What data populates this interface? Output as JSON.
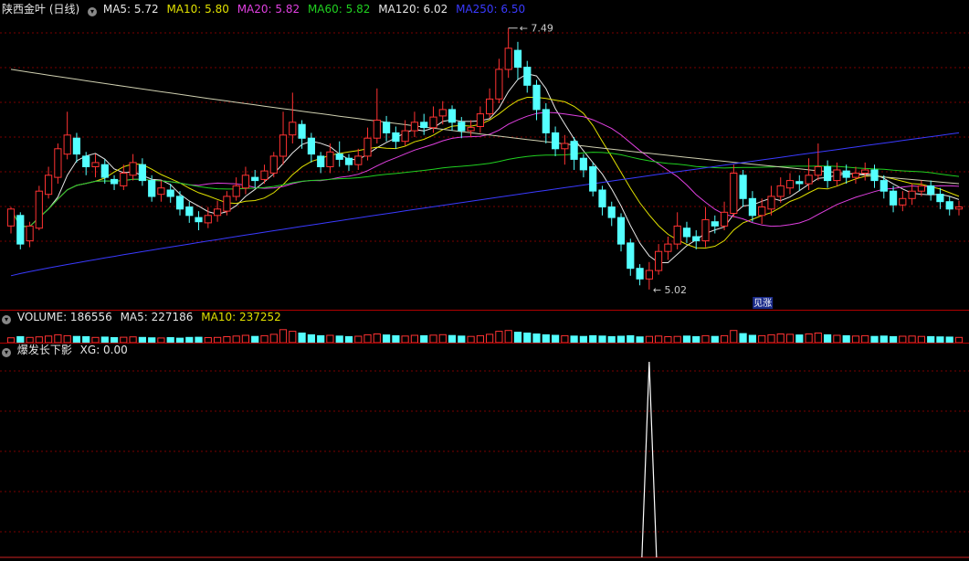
{
  "main": {
    "title": "陕西金叶 (日线)",
    "indicators": [
      {
        "label": "MA5: 5.72",
        "color": "#e6e6e6",
        "name": "ma5"
      },
      {
        "label": "MA10: 5.80",
        "color": "#e0e000",
        "name": "ma10"
      },
      {
        "label": "MA20: 5.82",
        "color": "#e040e0",
        "name": "ma20"
      },
      {
        "label": "MA60: 5.82",
        "color": "#20d020",
        "name": "ma60"
      },
      {
        "label": "MA120: 6.02",
        "color": "#cfcfb0",
        "name": "ma120"
      },
      {
        "label": "MA250: 6.50",
        "color": "#3a3aff",
        "name": "ma250"
      }
    ],
    "high_label": "7.49",
    "low_label": "5.02",
    "marker_label": "见涨"
  },
  "volume": {
    "title": "VOLUME: 186556",
    "ma5": "MA5: 227186",
    "ma10": "MA10: 237252"
  },
  "indicator": {
    "title": "爆发长下影",
    "value": "XG: 0.00"
  },
  "colors": {
    "up": "#ff3232",
    "down": "#54ffff",
    "grid": "#7a0000",
    "border": "#b00000"
  },
  "chart_data": {
    "type": "candlestick",
    "price_range": [
      4.95,
      7.6
    ],
    "extremes": {
      "high": 7.49,
      "low": 5.02
    },
    "moving_averages": {
      "MA5": 5.72,
      "MA10": 5.8,
      "MA20": 5.82,
      "MA60": 5.82,
      "MA120": 6.02,
      "MA250": 6.5
    },
    "candles": [
      [
        5.62,
        5.78,
        5.55,
        5.8
      ],
      [
        5.72,
        5.45,
        5.4,
        5.75
      ],
      [
        5.48,
        5.62,
        5.42,
        5.66
      ],
      [
        5.6,
        5.95,
        5.58,
        6.0
      ],
      [
        5.92,
        6.1,
        5.88,
        6.18
      ],
      [
        6.08,
        6.35,
        6.02,
        6.4
      ],
      [
        6.3,
        6.48,
        6.25,
        6.7
      ],
      [
        6.45,
        6.3,
        6.22,
        6.5
      ],
      [
        6.28,
        6.18,
        6.1,
        6.32
      ],
      [
        6.18,
        6.22,
        6.08,
        6.3
      ],
      [
        6.2,
        6.08,
        6.02,
        6.25
      ],
      [
        6.06,
        6.02,
        5.96,
        6.1
      ],
      [
        6.0,
        6.12,
        5.96,
        6.2
      ],
      [
        6.1,
        6.22,
        6.05,
        6.3
      ],
      [
        6.2,
        6.05,
        6.0,
        6.26
      ],
      [
        6.05,
        5.9,
        5.85,
        6.1
      ],
      [
        5.92,
        5.98,
        5.85,
        6.05
      ],
      [
        5.96,
        5.9,
        5.84,
        6.02
      ],
      [
        5.9,
        5.78,
        5.72,
        5.95
      ],
      [
        5.8,
        5.72,
        5.65,
        5.85
      ],
      [
        5.7,
        5.66,
        5.58,
        5.76
      ],
      [
        5.65,
        5.72,
        5.6,
        5.8
      ],
      [
        5.72,
        5.78,
        5.66,
        5.86
      ],
      [
        5.76,
        5.9,
        5.72,
        5.95
      ],
      [
        5.9,
        6.0,
        5.86,
        6.08
      ],
      [
        5.98,
        6.1,
        5.92,
        6.18
      ],
      [
        6.08,
        6.05,
        5.98,
        6.15
      ],
      [
        6.06,
        6.14,
        6.02,
        6.2
      ],
      [
        6.12,
        6.28,
        6.08,
        6.32
      ],
      [
        6.28,
        6.48,
        6.2,
        6.7
      ],
      [
        6.48,
        6.6,
        6.4,
        6.88
      ],
      [
        6.58,
        6.45,
        6.35,
        6.62
      ],
      [
        6.45,
        6.3,
        6.22,
        6.5
      ],
      [
        6.28,
        6.18,
        6.12,
        6.32
      ],
      [
        6.18,
        6.32,
        6.12,
        6.4
      ],
      [
        6.3,
        6.25,
        6.18,
        6.42
      ],
      [
        6.26,
        6.2,
        6.14,
        6.3
      ],
      [
        6.2,
        6.28,
        6.15,
        6.35
      ],
      [
        6.28,
        6.45,
        6.24,
        6.55
      ],
      [
        6.45,
        6.62,
        6.4,
        6.92
      ],
      [
        6.6,
        6.5,
        6.42,
        6.66
      ],
      [
        6.5,
        6.42,
        6.35,
        6.56
      ],
      [
        6.42,
        6.52,
        6.38,
        6.62
      ],
      [
        6.52,
        6.6,
        6.46,
        6.7
      ],
      [
        6.6,
        6.55,
        6.48,
        6.68
      ],
      [
        6.55,
        6.65,
        6.5,
        6.75
      ],
      [
        6.66,
        6.72,
        6.58,
        6.8
      ],
      [
        6.72,
        6.6,
        6.52,
        6.76
      ],
      [
        6.6,
        6.52,
        6.45,
        6.65
      ],
      [
        6.52,
        6.55,
        6.46,
        6.62
      ],
      [
        6.56,
        6.68,
        6.5,
        6.75
      ],
      [
        6.68,
        6.82,
        6.64,
        6.92
      ],
      [
        6.82,
        7.1,
        6.78,
        7.2
      ],
      [
        7.1,
        7.3,
        7.02,
        7.49
      ],
      [
        7.28,
        7.12,
        7.0,
        7.36
      ],
      [
        7.12,
        6.95,
        6.88,
        7.18
      ],
      [
        6.95,
        6.72,
        6.62,
        7.0
      ],
      [
        6.72,
        6.5,
        6.4,
        6.78
      ],
      [
        6.5,
        6.35,
        6.28,
        6.56
      ],
      [
        6.35,
        6.4,
        6.2,
        6.48
      ],
      [
        6.42,
        6.25,
        6.15,
        6.46
      ],
      [
        6.26,
        6.15,
        6.08,
        6.3
      ],
      [
        6.18,
        5.95,
        5.9,
        6.22
      ],
      [
        5.96,
        5.8,
        5.72,
        6.0
      ],
      [
        5.8,
        5.7,
        5.62,
        5.85
      ],
      [
        5.7,
        5.45,
        5.38,
        5.74
      ],
      [
        5.46,
        5.22,
        5.15,
        5.5
      ],
      [
        5.22,
        5.12,
        5.06,
        5.26
      ],
      [
        5.12,
        5.2,
        5.02,
        5.28
      ],
      [
        5.2,
        5.38,
        5.16,
        5.45
      ],
      [
        5.38,
        5.45,
        5.3,
        5.52
      ],
      [
        5.45,
        5.62,
        5.4,
        5.75
      ],
      [
        5.6,
        5.52,
        5.46,
        5.66
      ],
      [
        5.52,
        5.48,
        5.4,
        5.58
      ],
      [
        5.48,
        5.68,
        5.42,
        5.8
      ],
      [
        5.66,
        5.62,
        5.55,
        5.72
      ],
      [
        5.62,
        5.75,
        5.58,
        5.85
      ],
      [
        5.74,
        6.12,
        5.7,
        6.2
      ],
      [
        6.1,
        5.88,
        5.8,
        6.15
      ],
      [
        5.88,
        5.72,
        5.66,
        5.95
      ],
      [
        5.72,
        5.8,
        5.64,
        5.88
      ],
      [
        5.78,
        5.9,
        5.72,
        6.0
      ],
      [
        5.9,
        6.0,
        5.84,
        6.08
      ],
      [
        5.98,
        6.05,
        5.92,
        6.12
      ],
      [
        6.04,
        6.02,
        5.95,
        6.1
      ],
      [
        6.02,
        6.1,
        5.96,
        6.26
      ],
      [
        6.1,
        6.18,
        6.05,
        6.4
      ],
      [
        6.18,
        6.05,
        5.98,
        6.24
      ],
      [
        6.05,
        6.15,
        6.0,
        6.22
      ],
      [
        6.14,
        6.08,
        6.02,
        6.2
      ],
      [
        6.08,
        6.12,
        6.02,
        6.18
      ],
      [
        6.12,
        6.15,
        6.05,
        6.22
      ],
      [
        6.15,
        6.05,
        5.98,
        6.2
      ],
      [
        6.05,
        5.95,
        5.88,
        6.1
      ],
      [
        5.95,
        5.82,
        5.75,
        6.0
      ],
      [
        5.82,
        5.88,
        5.76,
        5.95
      ],
      [
        5.88,
        5.95,
        5.82,
        6.02
      ],
      [
        5.95,
        6.0,
        5.9,
        6.05
      ],
      [
        6.0,
        5.92,
        5.86,
        6.05
      ],
      [
        5.92,
        5.85,
        5.78,
        5.98
      ],
      [
        5.85,
        5.78,
        5.72,
        5.9
      ],
      [
        5.78,
        5.8,
        5.72,
        5.86
      ]
    ],
    "volumes": [
      0.28,
      0.35,
      0.3,
      0.33,
      0.38,
      0.45,
      0.4,
      0.36,
      0.34,
      0.3,
      0.32,
      0.29,
      0.31,
      0.33,
      0.3,
      0.28,
      0.27,
      0.29,
      0.26,
      0.3,
      0.31,
      0.29,
      0.3,
      0.34,
      0.38,
      0.42,
      0.36,
      0.4,
      0.48,
      0.75,
      0.65,
      0.55,
      0.45,
      0.4,
      0.42,
      0.38,
      0.35,
      0.37,
      0.45,
      0.5,
      0.44,
      0.4,
      0.38,
      0.42,
      0.4,
      0.43,
      0.46,
      0.41,
      0.38,
      0.36,
      0.4,
      0.48,
      0.65,
      0.7,
      0.6,
      0.55,
      0.5,
      0.45,
      0.42,
      0.4,
      0.38,
      0.36,
      0.4,
      0.38,
      0.35,
      0.37,
      0.4,
      0.33,
      0.36,
      0.38,
      0.34,
      0.36,
      0.38,
      0.35,
      0.4,
      0.36,
      0.4,
      0.7,
      0.52,
      0.42,
      0.4,
      0.45,
      0.5,
      0.48,
      0.44,
      0.5,
      0.55,
      0.45,
      0.42,
      0.4,
      0.38,
      0.4,
      0.36,
      0.38,
      0.35,
      0.37,
      0.38,
      0.36,
      0.35,
      0.33,
      0.32,
      0.3
    ],
    "xg_signal_index": 68
  }
}
